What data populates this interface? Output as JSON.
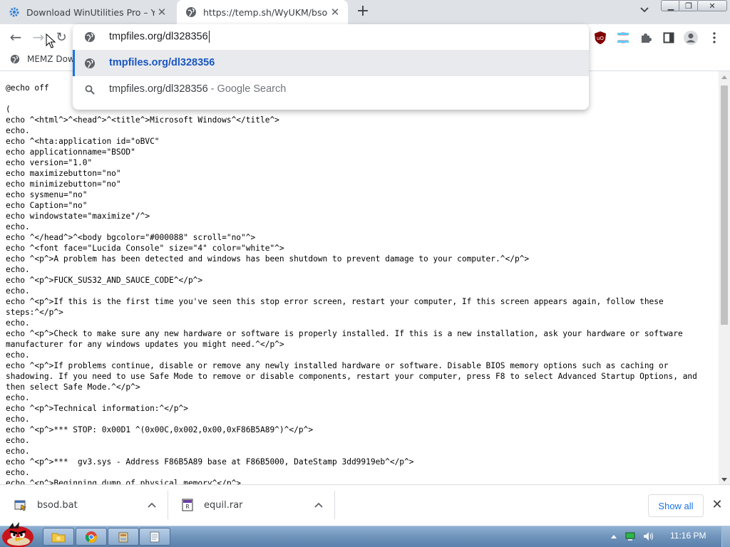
{
  "tabs": [
    {
      "title": "Download WinUtilities Pro – Y",
      "icon": "gear-icon"
    },
    {
      "title": "https://temp.sh/WyUKM/bsod",
      "icon": "globe-icon"
    }
  ],
  "new_tab_label": "+",
  "tab_search_label": "⌄",
  "window_controls": {
    "minimize": "▁",
    "maximize": "❐",
    "close": "✕"
  },
  "toolbar": {
    "back": "←",
    "forward": "→",
    "reload": "↻"
  },
  "omnibox": {
    "input_value": "tmpfiles.org/dl328356",
    "suggestions": [
      {
        "text": "tmpfiles.org/dl328356",
        "hint": "",
        "icon": "globe-icon"
      },
      {
        "text": "tmpfiles.org/dl328356",
        "hint": " - Google Search",
        "icon": "search-icon"
      }
    ]
  },
  "bookmarks": [
    {
      "label": "MEMZ Dow"
    }
  ],
  "page": {
    "lines": [
      "@echo off",
      "",
      "(",
      "echo ^<html^>^<head^>^<title^>Microsoft Windows^</title^>",
      "echo.",
      "echo ^<hta:application id=\"oBVC\"",
      "echo applicationname=\"BSOD\"",
      "echo version=\"1.0\"",
      "echo maximizebutton=\"no\"",
      "echo minimizebutton=\"no\"",
      "echo sysmenu=\"no\"",
      "echo Caption=\"no\"",
      "echo windowstate=\"maximize\"/^>",
      "echo.",
      "echo ^</head^>^<body bgcolor=\"#000088\" scroll=\"no\"^>",
      "echo ^<font face=\"Lucida Console\" size=\"4\" color=\"white\"^>",
      "echo ^<p^>A problem has been detected and windows has been shutdown to prevent damage to your computer.^</p^>",
      "echo.",
      "echo ^<p^>FUCK_SUS32_AND_SAUCE_CODE^</p^>",
      "echo.",
      "echo ^<p^>If this is the first time you've seen this stop error screen, restart your computer, If this screen appears again, follow these steps:^</p^>",
      "echo.",
      "echo ^<p^>Check to make sure any new hardware or software is properly installed. If this is a new installation, ask your hardware or software manufacturer for any windows updates you might need.^</p^>",
      "echo.",
      "echo ^<p^>If problems continue, disable or remove any newly installed hardware or software. Disable BIOS memory options such as caching or shadowing. If you need to use Safe Mode to remove or disable components, restart your computer, press F8 to select Advanced Startup Options, and then select Safe Mode.^</p^>",
      "echo.",
      "echo ^<p^>Technical information:^</p^>",
      "echo.",
      "echo ^<p^>*** STOP: 0x00D1 ^(0x00C,0x002,0x00,0xF86B5A89^)^</p^>",
      "echo.",
      "echo.",
      "echo ^<p^>***  gv3.sys - Address F86B5A89 base at F86B5000, DateStamp 3dd9919eb^</p^>",
      "echo.",
      "echo ^<p^>Beginning dump of physical memory^</p^>"
    ]
  },
  "downloads": [
    {
      "name": "bsod.bat",
      "icon": "batch-file-icon"
    },
    {
      "name": "equil.rar",
      "icon": "rar-archive-icon"
    }
  ],
  "downloads_bar": {
    "show_all": "Show all",
    "close": "✕"
  },
  "taskbar": {
    "clock": "11:16 PM"
  },
  "colors": {
    "accent": "#1a73e8",
    "tab_strip": "#dee1e6",
    "taskbar": "#6f93bb"
  }
}
